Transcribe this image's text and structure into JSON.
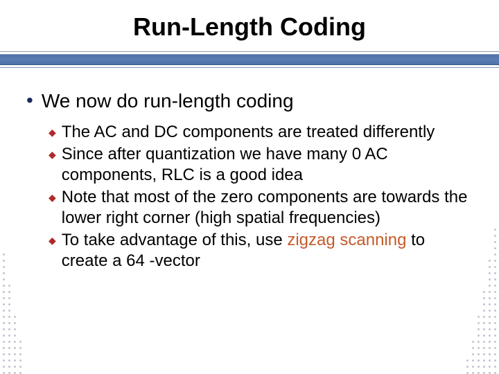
{
  "title": "Run-Length Coding",
  "main_bullet": "We now do run-length coding",
  "sub_bullets": {
    "b0": "The AC and DC components are treated differently",
    "b1": "Since after quantization we have many 0 AC components, RLC is a good idea",
    "b2": "Note that most of the zero components are towards the lower right corner (high spatial frequencies)",
    "b3_prefix": "To take advantage of this, use ",
    "b3_highlight": "zigzag scanning",
    "b3_suffix": " to create a 64 -vector"
  }
}
